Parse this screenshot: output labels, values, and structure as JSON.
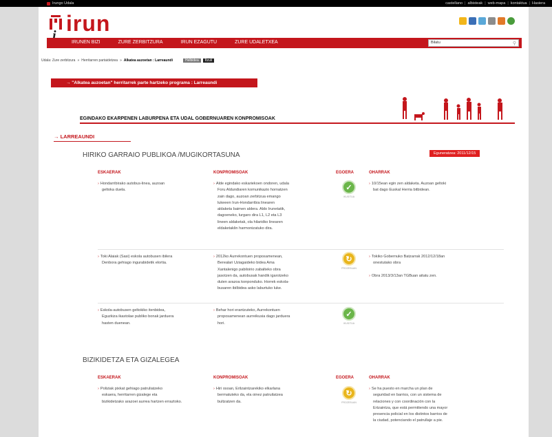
{
  "topbar": {
    "left": "Irungo Udala",
    "links": [
      "castellano",
      "albisteak",
      "web-mapa",
      "kontaktua",
      "Hasiera"
    ]
  },
  "logo": "irun",
  "nav": {
    "items": [
      "IRUNEN BIZI",
      "ZURE ZERBITZURA",
      "IRUN EZAGUTU",
      "ZURE UDALETXEA"
    ],
    "search_placeholder": "Bilatu"
  },
  "breadcrumb": {
    "parts": [
      "Udala: Zure zerbitzura",
      "Herritarren partaidetzea",
      "Alkatea auzoetan : Larreaundi"
    ],
    "tags": [
      "Helbidea",
      "Itzuli"
    ]
  },
  "promo": "→ \"Alkatea auzoetan\" herritarrek parte hartzeko programa : Larreaundi",
  "hero_title": "EGINDAKO EKARPENEN LABURPENA ETA UDAL GOBERNUAREN KONPROMISOAK",
  "locale": "→ LARREAUNDI",
  "section1": {
    "title": "HIRIKO GARRAIO PUBLIKOA /MUGIKORTASUNA",
    "date_badge": "Eguneratzea: 2011/12/15",
    "headers": [
      "ESKAERAK",
      "KONPROMISOAK",
      "EGOERA",
      "OHARRAK"
    ],
    "rows": [
      {
        "request": [
          "Hondarribirako autobus-linea, auzoan",
          "geltoka duela."
        ],
        "commitment": [
          "Alde egindako eskariekoen ondoren, udala",
          "Foru Aldundiaren komunikazio hornatzen",
          "zain dago, auzoan zerbitzua emango",
          "lukeeen Irun-Hondarribia linearen",
          "aldaketa baimen aldera. Aldo Irunetatik,",
          "dagoeneko, lurgaro dira L1, L2 eta L3",
          "lineen aldaketak, ola hilaridko linearen",
          "eldaketaklin harmonizatuko dira."
        ],
        "status": "check",
        "status_label": "IKUSITUA",
        "notes": [
          [
            "10/15ean egin zen aldaketa. Auzoan geltoki",
            "bat dago Euskal Herria bitbidean."
          ]
        ]
      },
      {
        "request": [
          "Toki Alaiak (Sasi) eskola autobusen ibilera",
          "Denbora gehiago ingurabidetik elortia."
        ],
        "commitment": [
          "2012ko Aurrekontuen proposamenean,",
          "Berealari Uziagaideko bidea Ama",
          "Xantalenigo pabiloirio zabalteko obra",
          "jasotzen da, autobusak handik igarotzeko",
          "duten arazoa konponduko. Horrek eskola-",
          "busaren ibilbidea asko laburtuko luke."
        ],
        "status": "pending",
        "status_label": "PROZESUAN",
        "notes": [
          [
            "Tokiko Gobernuko Batzarrak 2012/12/18an",
            "onestutako obra"
          ],
          [
            "Obra 2013/3/13an TGBuan aitatu zen."
          ]
        ]
      },
      {
        "request": [
          "Eskola-autobusen geltokiko itenbidea,",
          "Eguzkiza ikastolae publiko bonak jarduera",
          "hasten duenean."
        ],
        "commitment": [
          "Behar hori erantzuteko, Aurrekontuen",
          "proposamenean aurreikusia dago jarduera",
          "hori."
        ],
        "status": "check",
        "status_label": "IKUSITUA",
        "notes": []
      }
    ]
  },
  "section2": {
    "title": "BIZIKIDETZA ETA GIZALEGEA",
    "headers": [
      "ESKAERAK",
      "KONPROMISOAK",
      "EGOERA",
      "OHARRAK"
    ],
    "rows": [
      {
        "request": [
          "Poliziak pixkat gehiago patruliatzeko",
          "eskaera, herritarren gizalege eta",
          "bizikidetzako arazoei aurrea hartzen erraztoko."
        ],
        "commitment": [
          "Hiri osoan, Erilzaintzarekiko elkarlana",
          "bermatuteko da, ela oinez patruilatzea",
          "bultzatzen da."
        ],
        "status": "pending",
        "status_label": "PROZESUAN",
        "notes": [
          [
            "Se ha puesto en marcha un plan de",
            "seguridad en barrios, con un sistema de",
            "relaciones y con coordinación con la",
            "Ertzaintza, que está permitiendo una mayor",
            "presencia policial en los distintos barrios de",
            "la ciudad, potenciando el patrullaje a pie."
          ]
        ]
      }
    ]
  },
  "colors": {
    "brand_red": "#c4161c",
    "check_green": "#6bb64a",
    "pending_yellow": "#e9b51c"
  }
}
